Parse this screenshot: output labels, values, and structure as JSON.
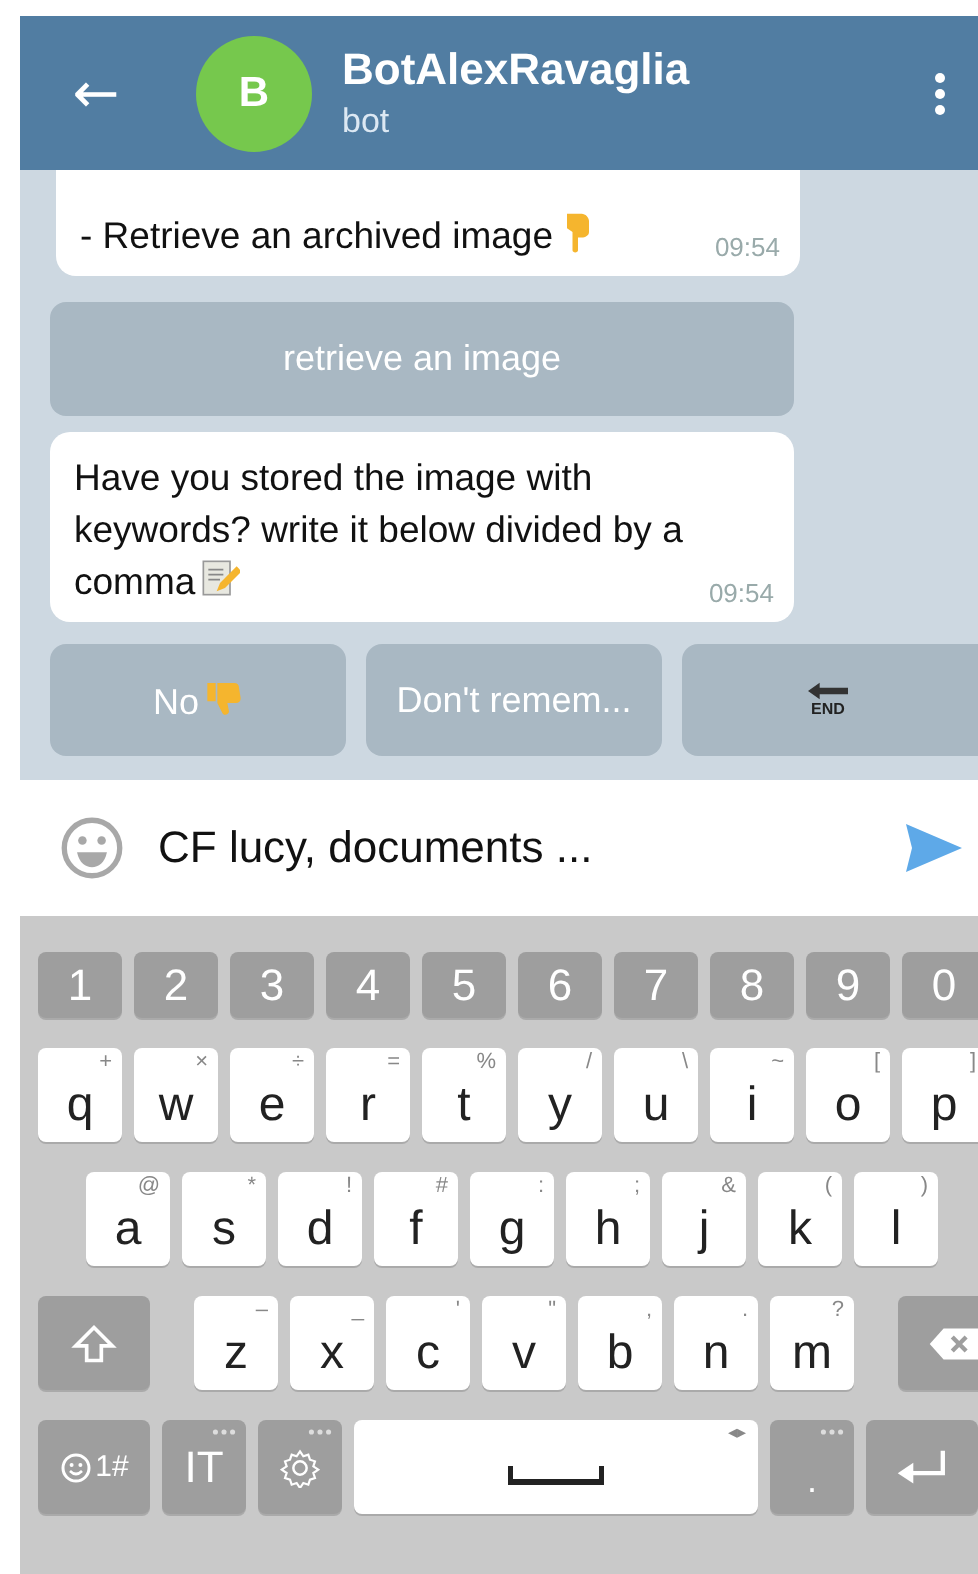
{
  "header": {
    "back": "←",
    "avatar_letter": "B",
    "title": "BotAlexRavaglia",
    "subtitle": "bot"
  },
  "messages": [
    {
      "kind": "bubble",
      "text": "- Retrieve an archived image",
      "icon": {
        "kind": "point-down"
      },
      "time": "09:54"
    },
    {
      "kind": "inline_button",
      "text": "retrieve an image"
    },
    {
      "kind": "bubble",
      "text": "Have you stored the image with keywords? write it below divided by a comma",
      "icon": {
        "kind": "memo"
      },
      "time": "09:54"
    }
  ],
  "reply_buttons": [
    {
      "kind": "text",
      "text": "No",
      "icon": {
        "kind": "thumbs-down"
      }
    },
    {
      "kind": "text",
      "text": "Don't remem..."
    },
    {
      "kind": "end",
      "text": "END"
    }
  ],
  "composer": {
    "value": "CF lucy, documents ..."
  },
  "keyboard": {
    "number_row": [
      "1",
      "2",
      "3",
      "4",
      "5",
      "6",
      "7",
      "8",
      "9",
      "0"
    ],
    "rows": [
      [
        {
          "label": "q",
          "hint": "+"
        },
        {
          "label": "w",
          "hint": "×"
        },
        {
          "label": "e",
          "hint": "÷"
        },
        {
          "label": "r",
          "hint": "="
        },
        {
          "label": "t",
          "hint": "%"
        },
        {
          "label": "y",
          "hint": "/"
        },
        {
          "label": "u",
          "hint": "\\"
        },
        {
          "label": "i",
          "hint": "~"
        },
        {
          "label": "o",
          "hint": "["
        },
        {
          "label": "p",
          "hint": "]"
        }
      ],
      [
        {
          "label": "a",
          "hint": "@"
        },
        {
          "label": "s",
          "hint": "*"
        },
        {
          "label": "d",
          "hint": "!"
        },
        {
          "label": "f",
          "hint": "#"
        },
        {
          "label": "g",
          "hint": ":"
        },
        {
          "label": "h",
          "hint": ";"
        },
        {
          "label": "j",
          "hint": "&"
        },
        {
          "label": "k",
          "hint": "("
        },
        {
          "label": "l",
          "hint": ")"
        }
      ],
      [
        {
          "label": "z",
          "hint": "–"
        },
        {
          "label": "x",
          "hint": "_"
        },
        {
          "label": "c",
          "hint": "'"
        },
        {
          "label": "v",
          "hint": "\""
        },
        {
          "label": "b",
          "hint": ","
        },
        {
          "label": "n",
          "hint": "."
        },
        {
          "label": "m",
          "hint": "?"
        }
      ]
    ],
    "bottom": [
      {
        "kind": "symbols",
        "label": "1#"
      },
      {
        "kind": "lang",
        "label": "IT"
      },
      {
        "kind": "settings"
      },
      {
        "kind": "space",
        "hint": "◂▸"
      },
      {
        "kind": "period",
        "label": "."
      },
      {
        "kind": "enter"
      }
    ]
  }
}
